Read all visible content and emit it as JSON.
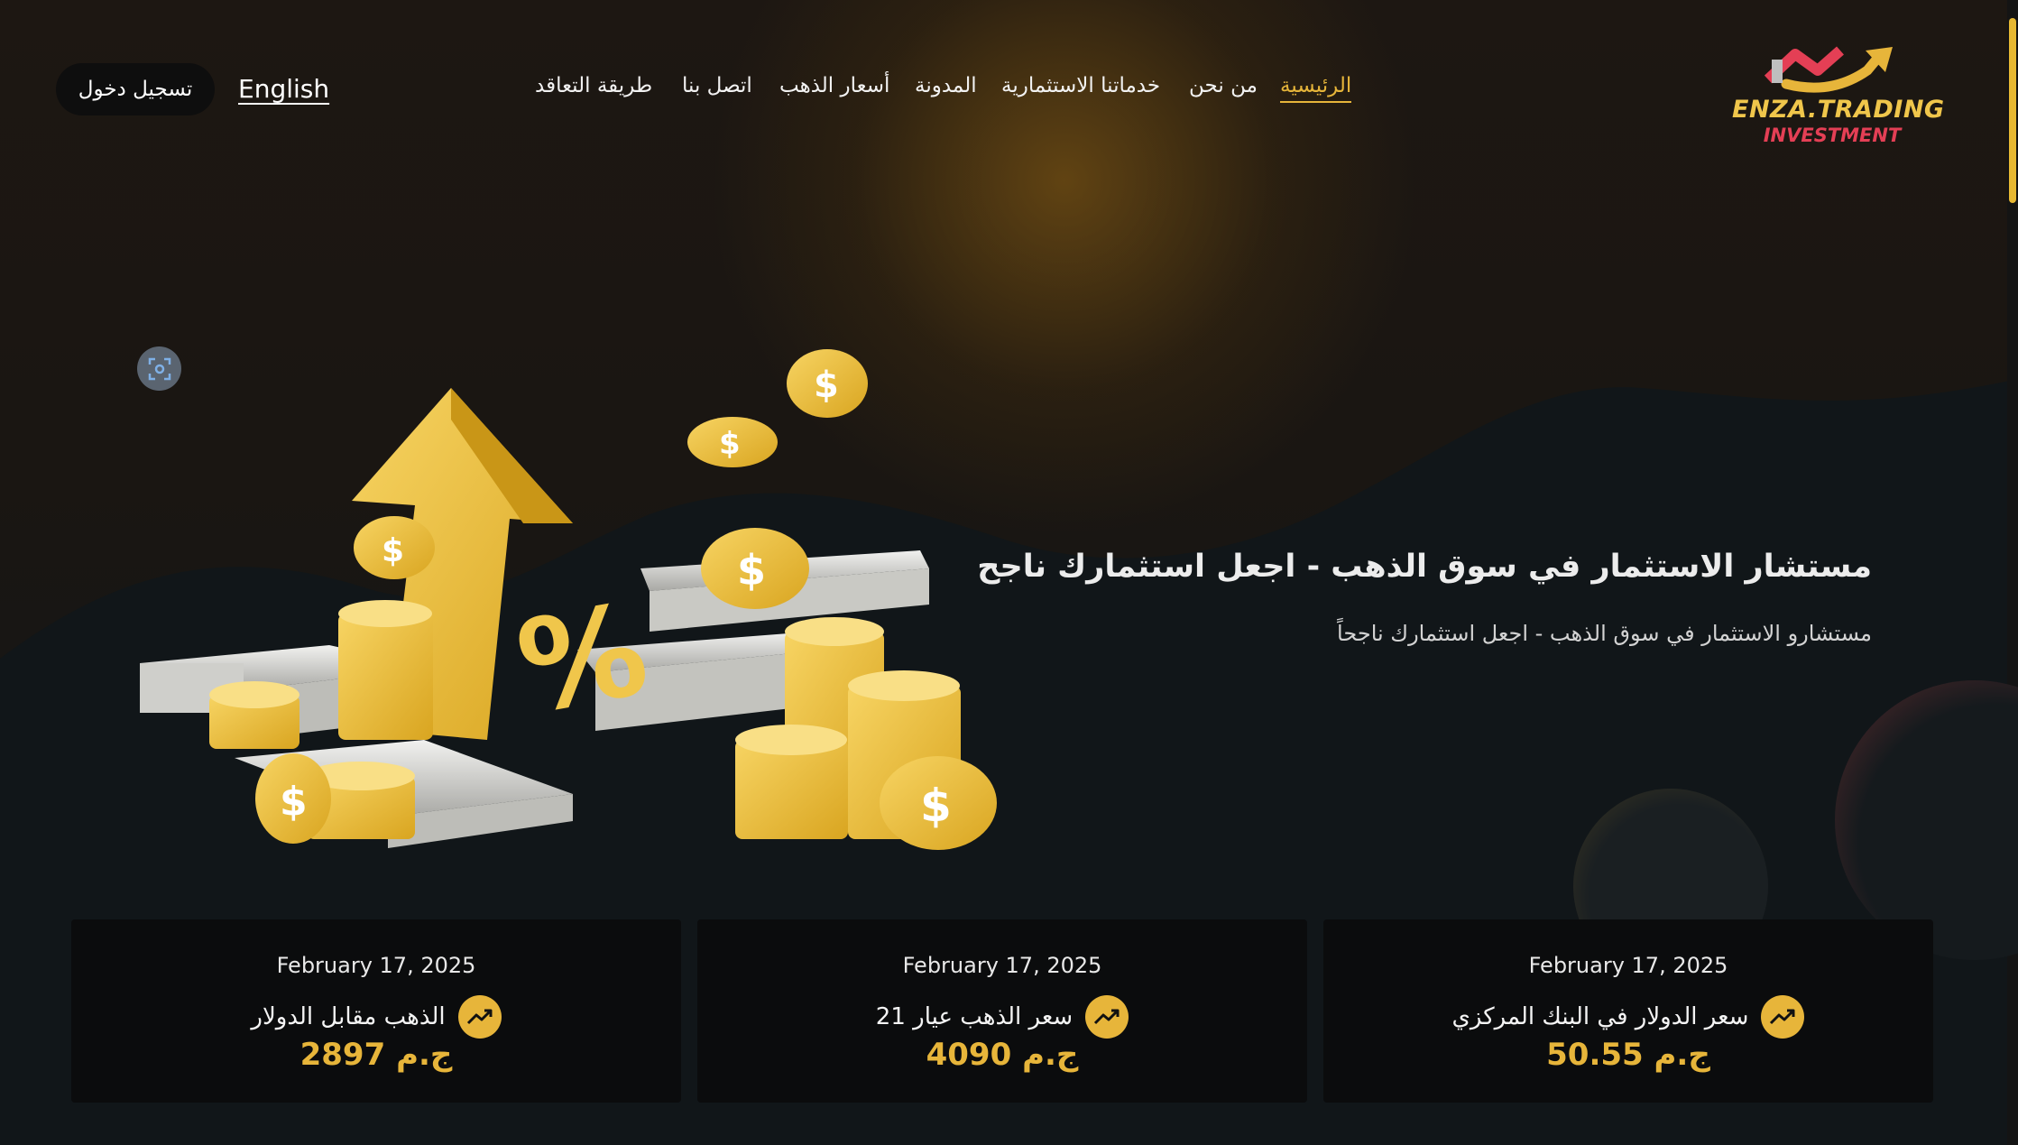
{
  "brand": {
    "name": "ENZA.TRADING",
    "subtitle": "INVESTMENT",
    "colors": {
      "gold": "#e7b53a",
      "red": "#e43f55"
    }
  },
  "nav": {
    "items": [
      {
        "label": "الرئيسية",
        "active": true
      },
      {
        "label": "من نحن",
        "active": false
      },
      {
        "label": "خدماتنا الاستثمارية",
        "active": false
      },
      {
        "label": "المدونة",
        "active": false
      },
      {
        "label": "أسعار الذهب",
        "active": false
      },
      {
        "label": "اتصل بنا",
        "active": false
      },
      {
        "label": "طريقة التعاقد",
        "active": false
      }
    ],
    "language_label": "English",
    "login_label": "تسجيل دخول"
  },
  "hero": {
    "title": "مستشار الاستثمار في سوق الذهب - اجعل استثمارك ناجح",
    "subtitle": "مستشارو الاستثمار في سوق الذهب - اجعل استثمارك ناجحاً"
  },
  "cards": [
    {
      "date": "February 17, 2025",
      "label": "الذهب مقابل الدولار",
      "price": "2897 ج.م",
      "icon": "trending-up-icon"
    },
    {
      "date": "February 17, 2025",
      "label": "سعر الذهب عيار 21",
      "price": "4090 ج.م",
      "icon": "trending-up-icon"
    },
    {
      "date": "February 17, 2025",
      "label": "سعر الدولار في البنك المركزي",
      "price": "50.55 ج.م",
      "icon": "trending-up-icon"
    }
  ]
}
